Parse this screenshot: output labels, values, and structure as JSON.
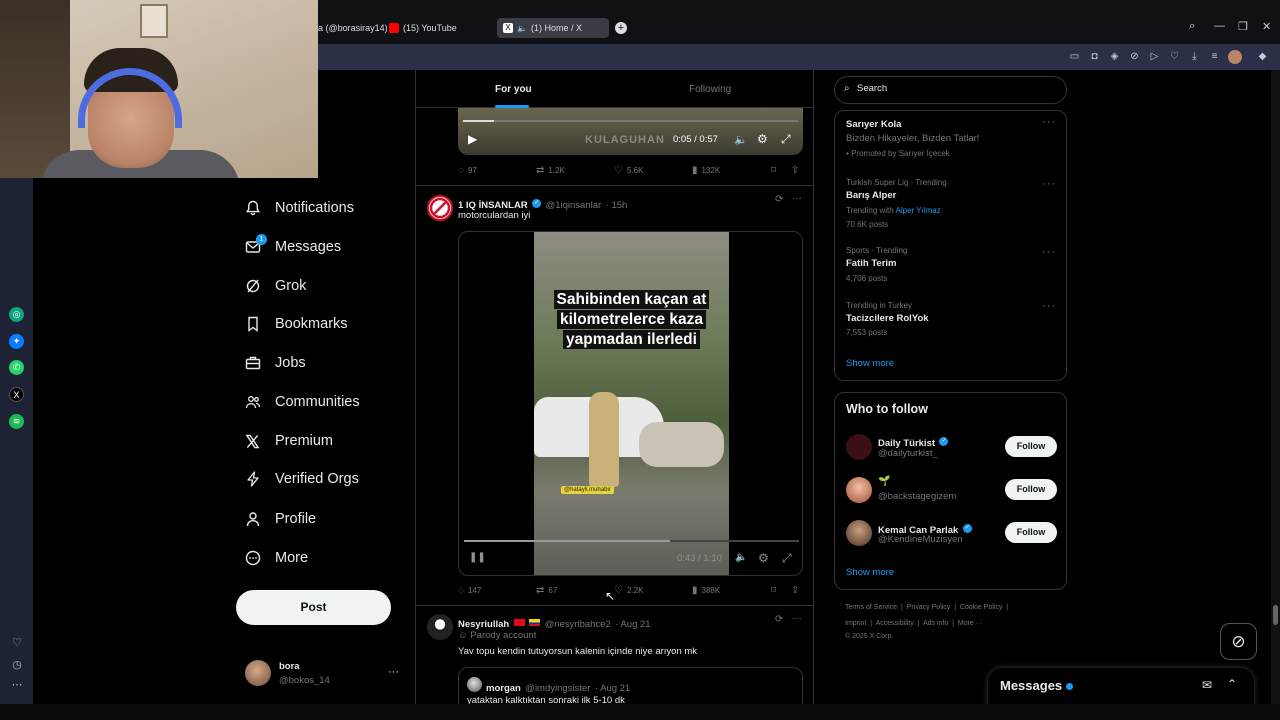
{
  "browser": {
    "tabs": [
      {
        "label": "a (@borasiray14) |"
      },
      {
        "label": "(15) YouTube"
      },
      {
        "label": "(1) Home / X"
      }
    ]
  },
  "nav": {
    "items": [
      {
        "label": "Notifications",
        "icon": "bell-icon"
      },
      {
        "label": "Messages",
        "icon": "envelope-icon",
        "badge": "1"
      },
      {
        "label": "Grok",
        "icon": "grok-icon"
      },
      {
        "label": "Bookmarks",
        "icon": "bookmark-icon"
      },
      {
        "label": "Jobs",
        "icon": "briefcase-icon"
      },
      {
        "label": "Communities",
        "icon": "people-icon"
      },
      {
        "label": "Premium",
        "icon": "x-logo-icon"
      },
      {
        "label": "Verified Orgs",
        "icon": "lightning-icon"
      },
      {
        "label": "Profile",
        "icon": "person-icon"
      },
      {
        "label": "More",
        "icon": "more-circle-icon"
      }
    ],
    "post_label": "Post",
    "account": {
      "name": "bora",
      "handle": "@bokos_14"
    }
  },
  "timeline": {
    "tabs": [
      {
        "label": "For you"
      },
      {
        "label": "Following"
      }
    ],
    "video1": {
      "time": "0:05 / 0:57",
      "watermark": "KULAGUHAN"
    },
    "tweet1_stats": {
      "replies": "97",
      "reposts": "1.2K",
      "likes": "5.6K",
      "views": "132K"
    },
    "tweet2": {
      "name": "1 IQ İNSANLAR",
      "handle": "@1iqinsanlar",
      "time": "· 15h",
      "text": "motorculardan iyi",
      "caption_lines": [
        "Sahibinden kaçan at",
        "kilometrelerce kaza",
        "yapmadan ilerledi"
      ],
      "tag": "@hatayli.muhabir",
      "video_time": "0:43 / 1:10",
      "replies": "147",
      "reposts": "67",
      "likes": "2.2K",
      "views": "388K"
    },
    "tweet3": {
      "name": "Nesyriullah",
      "handle": "@nesyribahce2",
      "time": "· Aug 21",
      "parody": "Parody account",
      "text": "Yav topu kendin tutuyorsun kalenin içinde niye arıyon mk",
      "quote_name": "morgan",
      "quote_handle": "@imdyingsister",
      "quote_time": "· Aug 21",
      "quote_text": "yataktan kalktıktan sonraki ilk 5-10 dk"
    }
  },
  "right": {
    "search_placeholder": "Search",
    "ad": {
      "title": "Sarıyer Kola",
      "subtitle": "Bizden Hikayeler, Bizden Tatlar!",
      "promoted": "Promoted by Sarıyer İçecek"
    },
    "trends": [
      {
        "context": "Turkish Super Lig · Trending",
        "title": "Barış Alper",
        "extra_prefix": "Trending with",
        "extra_link": "Alper Yılmaz",
        "posts": "70.6K posts"
      },
      {
        "context": "Sports · Trending",
        "title": "Fatih Terim",
        "posts": "4,706 posts"
      },
      {
        "context": "Trending in Turkey",
        "title": "Tacizcilere RolYok",
        "posts": "7,553 posts"
      }
    ],
    "show_more": "Show more",
    "who_to_follow": {
      "title": "Who to follow",
      "users": [
        {
          "name": "Daily Türkist",
          "handle": "@dailyturkist_",
          "verified": true
        },
        {
          "name": "",
          "handle": "@backstagegizem",
          "verified": false
        },
        {
          "name": "Kemal Can Parlak",
          "handle": "@KendineMuzisyen",
          "verified": true
        }
      ],
      "follow_label": "Follow",
      "show_more": "Show more"
    },
    "footer": {
      "line1": [
        "Terms of Service",
        "Privacy Policy",
        "Cookie Policy"
      ],
      "line2": [
        "Imprint",
        "Accessibility",
        "Ads info",
        "More ···"
      ],
      "copyright": "© 2025 X Corp."
    },
    "messages_label": "Messages"
  },
  "colors": {
    "accent": "#1d9bf0",
    "background": "#000000",
    "border": "#2f3336",
    "muted": "#71767b"
  }
}
